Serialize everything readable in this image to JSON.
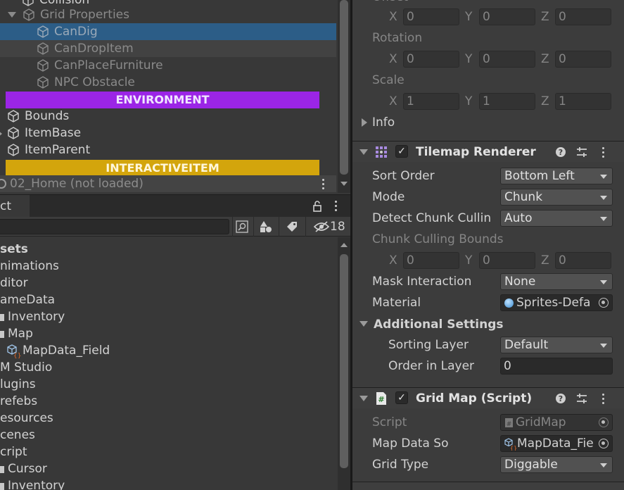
{
  "hierarchy": {
    "items": [
      {
        "label": "Collision"
      },
      {
        "label": "Grid Properties"
      },
      {
        "label": "CanDig"
      },
      {
        "label": "CanDropItem"
      },
      {
        "label": "CanPlaceFurniture"
      },
      {
        "label": "NPC Obstacle"
      },
      {
        "label": "ENVIRONMENT"
      },
      {
        "label": "Bounds"
      },
      {
        "label": "ItemBase"
      },
      {
        "label": "ItemParent"
      },
      {
        "label": "INTERACTIVEITEM"
      },
      {
        "label": "02_Home (not loaded)"
      }
    ],
    "banner_colors": {
      "environment": "#9b25e6",
      "interactiveitem": "#d3a50c"
    }
  },
  "project": {
    "tab_label": "ct",
    "hidden_count": "18",
    "items": [
      {
        "label": "sets"
      },
      {
        "label": "nimations"
      },
      {
        "label": "ditor"
      },
      {
        "label": "ameData"
      },
      {
        "label": "Inventory"
      },
      {
        "label": "Map"
      },
      {
        "label": "MapData_Field"
      },
      {
        "label": "M Studio"
      },
      {
        "label": "lugins"
      },
      {
        "label": "refebs"
      },
      {
        "label": "esources"
      },
      {
        "label": "cenes"
      },
      {
        "label": "cript"
      },
      {
        "label": "Cursor"
      },
      {
        "label": "Inventory"
      }
    ]
  },
  "inspector": {
    "transform": {
      "offset_label": "Offset",
      "rotation_label": "Rotation",
      "scale_label": "Scale",
      "axis_x": "X",
      "axis_y": "Y",
      "axis_z": "Z",
      "offset": {
        "x": "0",
        "y": "0",
        "z": "0"
      },
      "rotation": {
        "x": "0",
        "y": "0",
        "z": "0"
      },
      "scale": {
        "x": "1",
        "y": "1",
        "z": "1"
      },
      "info_label": "Info"
    },
    "tilemap_renderer": {
      "title": "Tilemap Renderer",
      "sort_order_label": "Sort Order",
      "sort_order_value": "Bottom Left",
      "mode_label": "Mode",
      "mode_value": "Chunk",
      "detect_label": "Detect Chunk Cullin",
      "detect_value": "Auto",
      "bounds_label": "Chunk Culling Bounds",
      "bounds": {
        "x": "0",
        "y": "0",
        "z": "0"
      },
      "mask_label": "Mask Interaction",
      "mask_value": "None",
      "material_label": "Material",
      "material_value": "Sprites-Defa",
      "additional_label": "Additional Settings",
      "sorting_layer_label": "Sorting Layer",
      "sorting_layer_value": "Default",
      "order_label": "Order in Layer",
      "order_value": "0"
    },
    "grid_map": {
      "title": "Grid Map (Script)",
      "script_label": "Script",
      "script_value": "GridMap",
      "map_data_label": "Map Data So",
      "map_data_value": "MapData_Fie",
      "grid_type_label": "Grid Type",
      "grid_type_value": "Diggable"
    }
  },
  "colors": {
    "selection": "#2c5d87",
    "accent_orange": "#e06a2a"
  }
}
